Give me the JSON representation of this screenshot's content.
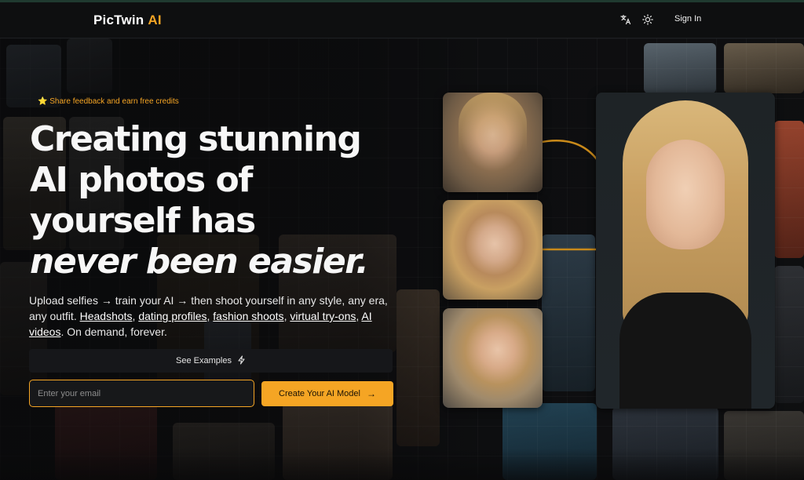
{
  "header": {
    "logo_text": "PicTwin",
    "logo_accent": "AI",
    "translate_icon": "translate-icon",
    "theme_icon": "sun-icon",
    "sign_in": "Sign In"
  },
  "hero": {
    "feedback": "⭐ Share feedback and earn free credits",
    "headline_lines": [
      "Creating stunning",
      "AI photos of",
      "yourself has"
    ],
    "headline_emphasis": "never been easier.",
    "sub_intro": "Upload selfies → train your AI → then shoot yourself in any style, any era, any outfit.",
    "sub_links": [
      "Headshots",
      "dating profiles",
      "fashion shoots",
      "virtual try-ons",
      "AI videos"
    ],
    "sub_outro": "On demand, forever.",
    "see_examples": "See Examples",
    "email_placeholder": "Enter your email",
    "cta": "Create Your AI Model"
  },
  "colors": {
    "accent": "#f5a524",
    "background": "#0b0b0c"
  }
}
